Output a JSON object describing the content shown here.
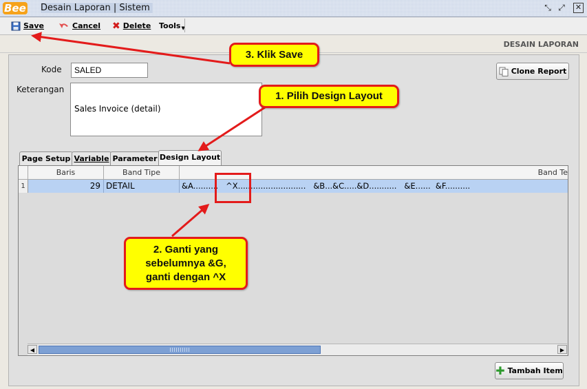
{
  "window": {
    "logo_text": "Bee",
    "title": "Desain Laporan | Sistem",
    "controls": [
      "restore",
      "maximize",
      "close"
    ]
  },
  "toolbar": {
    "save_label": "Save",
    "cancel_label": "Cancel",
    "delete_label": "Delete",
    "tools_label": "Tools"
  },
  "header": {
    "section_title": "DESAIN LAPORAN"
  },
  "form": {
    "kode_label": "Kode",
    "kode_value": "SALED",
    "keterangan_label": "Keterangan",
    "keterangan_value": "Sales Invoice (detail)",
    "clone_button": "Clone Report"
  },
  "tabs": [
    {
      "label": "Page Setup"
    },
    {
      "label": "Variable"
    },
    {
      "label": "Parameter"
    },
    {
      "label": "Design Layout",
      "active": true
    }
  ],
  "grid": {
    "columns": [
      "Baris",
      "Band Tipe",
      "Band Te"
    ],
    "rows": [
      {
        "index": "1",
        "baris": "29",
        "band_tipe": "DETAIL",
        "band_text": "&A..........   ^X...........................   &B...&C.....&D...........   &E......  &F.........."
      }
    ]
  },
  "footer": {
    "add_item_button": "Tambah Item"
  },
  "annotations": {
    "callout_save": "3. Klik Save",
    "callout_tab": "1. Pilih Design Layout",
    "callout_edit_line1": "2. Ganti yang",
    "callout_edit_line2": "sebelumnya &G,",
    "callout_edit_line3": "ganti dengan ^X"
  },
  "colors": {
    "titlebar": "#c7d3e6",
    "selected_row": "#b9d2f3",
    "callout_fill": "#ffff00",
    "callout_border": "#e31b1b",
    "scroll_thumb": "#7da0d4"
  }
}
